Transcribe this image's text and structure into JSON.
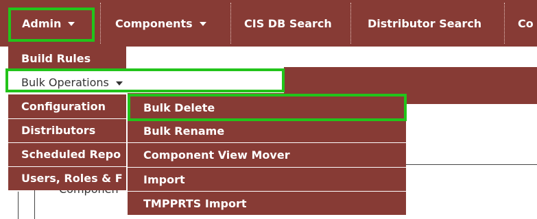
{
  "topnav": {
    "items": [
      {
        "label": "Admin"
      },
      {
        "label": "Components"
      },
      {
        "label": "CIS DB Search"
      },
      {
        "label": "Distributor Search"
      },
      {
        "label": "Co"
      }
    ]
  },
  "admin_menu": {
    "items": [
      {
        "label": "Build Rules"
      },
      {
        "label": "Bulk Operations"
      },
      {
        "label": "Configuration"
      },
      {
        "label": "Distributors"
      },
      {
        "label": "Scheduled Repo"
      },
      {
        "label": "Users, Roles & F"
      }
    ]
  },
  "bulk_operations_menu": {
    "items": [
      {
        "label": "Bulk Delete"
      },
      {
        "label": "Bulk Rename"
      },
      {
        "label": "Component View Mover"
      },
      {
        "label": "Import"
      },
      {
        "label": "TMPPRTS Import"
      }
    ]
  },
  "background": {
    "partial_text": "Componen"
  },
  "colors": {
    "nav_bg": "#873b35",
    "highlight": "#22c41a",
    "text_light": "#ffffff",
    "text_dark": "#333333"
  }
}
